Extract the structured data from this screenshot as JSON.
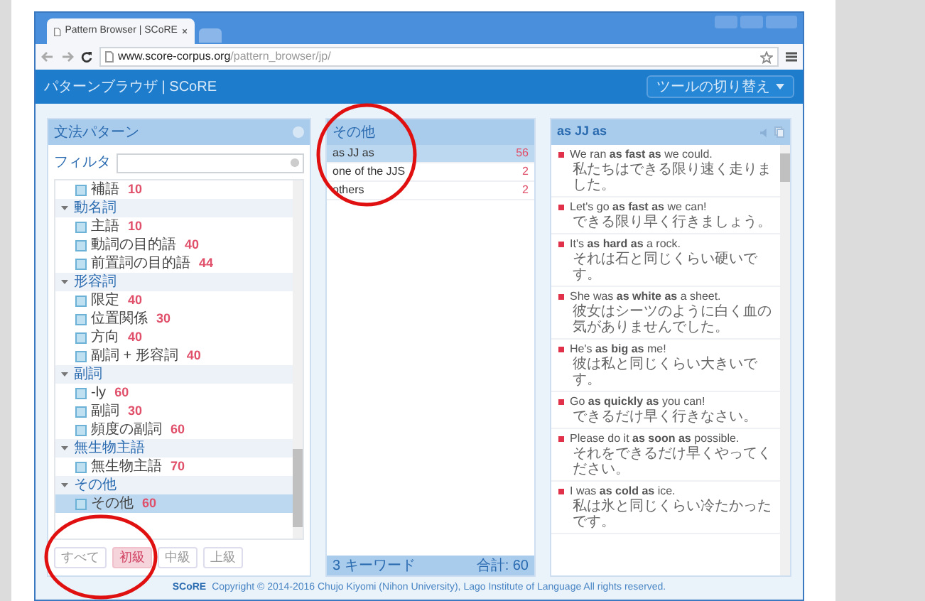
{
  "browser": {
    "tab_title": "Pattern Browser | SCoRE",
    "url_host": "www.score-corpus.org",
    "url_path": "/pattern_browser/jp/"
  },
  "app_bar": {
    "title": "パターンブラウザ | SCoRE",
    "tool_button": "ツールの切り替え"
  },
  "pattern_panel": {
    "title": "文法パターン",
    "filter_label": "フィルタ",
    "tree": [
      {
        "label": "補語",
        "count": "10",
        "selected": false
      },
      {
        "label": "動名詞",
        "expanded": true,
        "children": [
          {
            "label": "主語",
            "count": "10",
            "selected": false
          },
          {
            "label": "動詞の目的語",
            "count": "40",
            "selected": false
          },
          {
            "label": "前置詞の目的語",
            "count": "44",
            "selected": false
          }
        ]
      },
      {
        "label": "形容詞",
        "expanded": true,
        "children": [
          {
            "label": "限定",
            "count": "40",
            "selected": false
          },
          {
            "label": "位置関係",
            "count": "30",
            "selected": false
          },
          {
            "label": "方向",
            "count": "40",
            "selected": false
          },
          {
            "label": "副詞 + 形容詞",
            "count": "40",
            "selected": false
          }
        ]
      },
      {
        "label": "副詞",
        "expanded": true,
        "children": [
          {
            "label": "-ly",
            "count": "60",
            "selected": false
          },
          {
            "label": "副詞",
            "count": "30",
            "selected": false
          },
          {
            "label": "頻度の副詞",
            "count": "60",
            "selected": false
          }
        ]
      },
      {
        "label": "無生物主語",
        "expanded": true,
        "children": [
          {
            "label": "無生物主語",
            "count": "70",
            "selected": false
          }
        ]
      },
      {
        "label": "その他",
        "expanded": true,
        "children": [
          {
            "label": "その他",
            "count": "60",
            "selected": true
          }
        ]
      }
    ],
    "levels": [
      {
        "label": "すべて",
        "selected": false
      },
      {
        "label": "初級",
        "selected": true
      },
      {
        "label": "中級",
        "selected": false
      },
      {
        "label": "上級",
        "selected": false
      }
    ]
  },
  "keyword_panel": {
    "title": "その他",
    "rows": [
      {
        "label": "as JJ as",
        "count": "56",
        "selected": true
      },
      {
        "label": "one of the JJS",
        "count": "2",
        "selected": false
      },
      {
        "label": "others",
        "count": "2",
        "selected": false
      }
    ],
    "footer_left": "3 キーワード",
    "footer_right": "合計: 60"
  },
  "example_panel": {
    "title": "as JJ as",
    "examples": [
      {
        "en": "We ran **as fast as** we could.",
        "ja": "私たちはできる限り速く走りました。"
      },
      {
        "en": "Let's go **as fast as** we can!",
        "ja": "できる限り早く行きましょう。"
      },
      {
        "en": "It's **as hard as** a rock.",
        "ja": "それは石と同じくらい硬いです。"
      },
      {
        "en": "She was **as white as** a sheet.",
        "ja": "彼女はシーツのように白く血の気がありませんでした。"
      },
      {
        "en": "He's **as big as** me!",
        "ja": "彼は私と同じくらい大きいです。"
      },
      {
        "en": "Go **as quickly as** you can!",
        "ja": "できるだけ早く行きなさい。"
      },
      {
        "en": "Please do it **as soon as** possible.",
        "ja": "それをできるだけ早くやってください。"
      },
      {
        "en": "I was **as cold as** ice.",
        "ja": "私は氷と同じくらい冷たかったです。"
      }
    ]
  },
  "footer": {
    "brand": "SCoRE",
    "copyright": "Copyright © 2014-2016 Chujo Kiyomi (Nihon University), Lago Institute of Language All rights reserved."
  }
}
